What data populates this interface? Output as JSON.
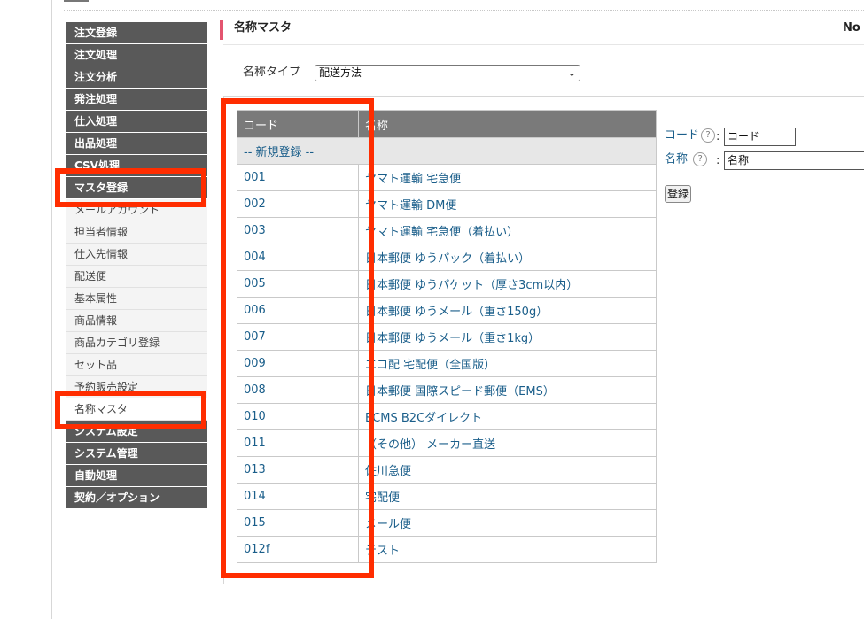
{
  "sidebar": {
    "items": [
      {
        "label": "注文登録",
        "type": "cat"
      },
      {
        "label": "注文処理",
        "type": "cat"
      },
      {
        "label": "注文分析",
        "type": "cat"
      },
      {
        "label": "発注処理",
        "type": "cat"
      },
      {
        "label": "仕入処理",
        "type": "cat"
      },
      {
        "label": "出品処理",
        "type": "cat"
      },
      {
        "label": "CSV処理",
        "type": "cat"
      },
      {
        "label": "マスタ登録",
        "type": "cat"
      },
      {
        "label": "メールアカウント",
        "type": "sub"
      },
      {
        "label": "担当者情報",
        "type": "sub"
      },
      {
        "label": "仕入先情報",
        "type": "sub"
      },
      {
        "label": "配送便",
        "type": "sub"
      },
      {
        "label": "基本属性",
        "type": "sub"
      },
      {
        "label": "商品情報",
        "type": "sub"
      },
      {
        "label": "商品カテゴリ登録",
        "type": "sub"
      },
      {
        "label": "セット品",
        "type": "sub"
      },
      {
        "label": "予約販売設定",
        "type": "sub"
      },
      {
        "label": "名称マスタ",
        "type": "sub",
        "active": true
      },
      {
        "label": "システム設定",
        "type": "cat"
      },
      {
        "label": "システム管理",
        "type": "cat"
      },
      {
        "label": "自動処理",
        "type": "cat"
      },
      {
        "label": "契約／オプション",
        "type": "cat"
      }
    ]
  },
  "page": {
    "title": "名称マスタ",
    "right_text": "No"
  },
  "filter": {
    "label": "名称タイプ",
    "selected": "配送方法"
  },
  "table": {
    "headers": [
      "コード",
      "名称"
    ],
    "new_row_label": "-- 新規登録 --",
    "rows": [
      {
        "code": "001",
        "name": "ヤマト運輸 宅急便"
      },
      {
        "code": "002",
        "name": "ヤマト運輸 DM便"
      },
      {
        "code": "003",
        "name": "ヤマト運輸 宅急便（着払い）"
      },
      {
        "code": "004",
        "name": "日本郵便 ゆうパック（着払い）"
      },
      {
        "code": "005",
        "name": "日本郵便 ゆうパケット（厚さ3cm以内）"
      },
      {
        "code": "006",
        "name": "日本郵便 ゆうメール（重さ150g）"
      },
      {
        "code": "007",
        "name": "日本郵便 ゆうメール（重さ1kg）"
      },
      {
        "code": "009",
        "name": "エコ配 宅配便（全国版）"
      },
      {
        "code": "008",
        "name": "日本郵便 国際スピード郵便（EMS）"
      },
      {
        "code": "010",
        "name": "ECMS B2Cダイレクト"
      },
      {
        "code": "011",
        "name": "（その他） メーカー直送"
      },
      {
        "code": "013",
        "name": "佐川急便"
      },
      {
        "code": "014",
        "name": "宅配便"
      },
      {
        "code": "015",
        "name": "メール便"
      },
      {
        "code": "012f",
        "name": "テスト"
      }
    ]
  },
  "form": {
    "code_label": "コード",
    "code_value": "コード",
    "name_label": "名称",
    "name_value": "名称",
    "help_glyph": "?",
    "colon": ":",
    "submit_label": "登録"
  },
  "colors": {
    "accent": "#e3546f",
    "highlight": "#ff2d00",
    "link": "#1a5e8a",
    "sidebar_cat_bg": "#595959"
  }
}
